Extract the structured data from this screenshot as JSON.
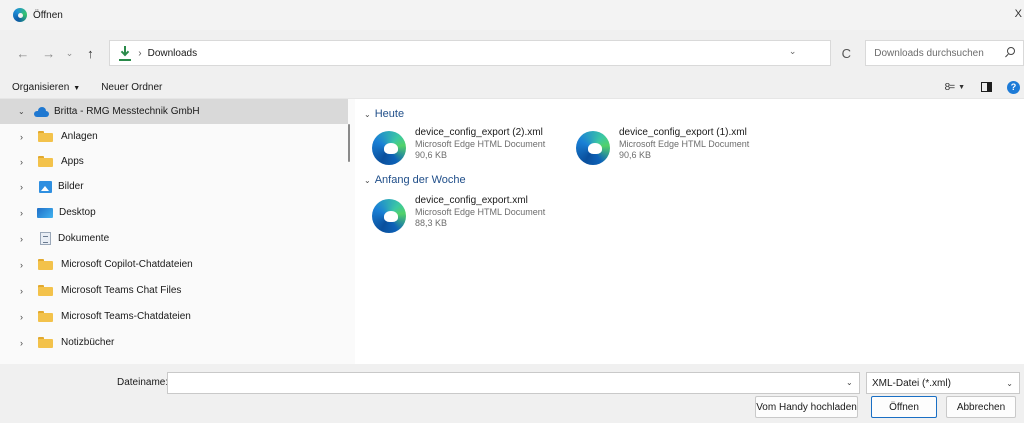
{
  "window": {
    "title": "Öffnen",
    "app_icon": "edge-icon",
    "close_glyph": "X"
  },
  "address": {
    "back_glyph": "←",
    "forward_glyph": "→",
    "history_glyph": "⌄",
    "up_glyph": "↑",
    "breadcrumb_sep": "›",
    "breadcrumb": "Downloads",
    "dropdown_glyph": "⌄",
    "refresh_glyph": "C",
    "search_placeholder": "Downloads durchsuchen"
  },
  "toolbar": {
    "organize_label": "Organisieren",
    "organize_caret": "▼",
    "new_folder_label": "Neuer Ordner",
    "view_glyph": "8=",
    "view_caret": "▼",
    "help_glyph": "?"
  },
  "sidebar": {
    "root": {
      "label": "Britta - RMG Messtechnik GmbH",
      "chevron": "⌄",
      "icon": "onedrive-cloud-icon"
    },
    "items": [
      {
        "label": "Anlagen",
        "chevron": "›",
        "icon": "folder-icon"
      },
      {
        "label": "Apps",
        "chevron": "›",
        "icon": "folder-icon"
      },
      {
        "label": "Bilder",
        "chevron": "›",
        "icon": "pictures-icon"
      },
      {
        "label": "Desktop",
        "chevron": "›",
        "icon": "desktop-icon"
      },
      {
        "label": "Dokumente",
        "chevron": "›",
        "icon": "documents-icon"
      },
      {
        "label": "Microsoft Copilot-Chatdateien",
        "chevron": "›",
        "icon": "folder-icon"
      },
      {
        "label": "Microsoft Teams Chat Files",
        "chevron": "›",
        "icon": "folder-icon"
      },
      {
        "label": "Microsoft Teams-Chatdateien",
        "chevron": "›",
        "icon": "folder-icon"
      },
      {
        "label": "Notizbücher",
        "chevron": "›",
        "icon": "folder-icon"
      }
    ]
  },
  "groups": [
    {
      "header": "Heute",
      "chevron": "⌄",
      "files": [
        {
          "name": "device_config_export (2).xml",
          "type": "Microsoft Edge HTML Document",
          "size": "90,6 KB",
          "icon": "edge-icon"
        },
        {
          "name": "device_config_export (1).xml",
          "type": "Microsoft Edge HTML Document",
          "size": "90,6 KB",
          "icon": "edge-icon"
        }
      ]
    },
    {
      "header": "Anfang der Woche",
      "chevron": "⌄",
      "files": [
        {
          "name": "device_config_export.xml",
          "type": "Microsoft Edge HTML Document",
          "size": "88,3 KB",
          "icon": "edge-icon"
        }
      ]
    }
  ],
  "bottom": {
    "filename_label": "Dateiname:",
    "filename_value": "",
    "filename_dropdown_glyph": "⌄",
    "filter_value": "XML-Datei (*.xml)",
    "filter_dropdown_glyph": "⌄",
    "upload_label": "Vom Handy hochladen",
    "open_label": "Öffnen",
    "cancel_label": "Abbrechen"
  },
  "colors": {
    "accent": "#1a6fc4",
    "group_header": "#1f4e89",
    "folder": "#f3c24b",
    "selection": "#d9d9d9"
  }
}
